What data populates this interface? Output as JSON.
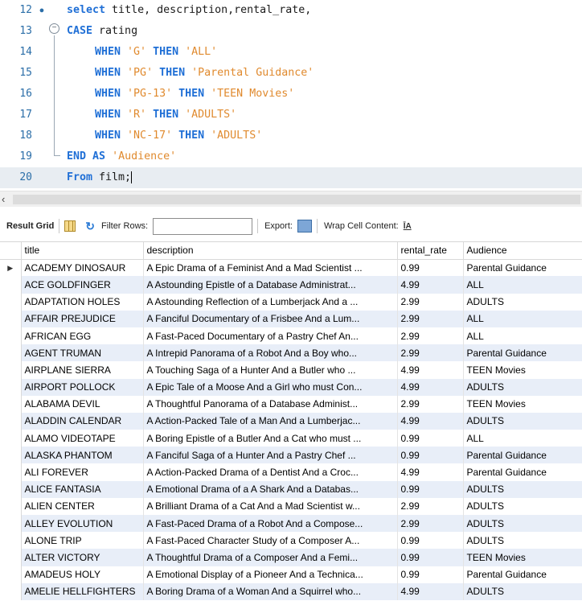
{
  "editor": {
    "lines": [
      {
        "num": "12",
        "parts": [
          {
            "t": "select",
            "k": "kw"
          },
          {
            "t": " title, description,rental_rate,",
            "k": ""
          }
        ]
      },
      {
        "num": "13",
        "parts": [
          {
            "t": "CASE",
            "k": "kw"
          },
          {
            "t": " rating",
            "k": ""
          }
        ]
      },
      {
        "num": "14",
        "parts": [
          {
            "t": "WHEN",
            "k": "kw"
          },
          {
            "t": " ",
            "k": ""
          },
          {
            "t": "'G'",
            "k": "str"
          },
          {
            "t": " ",
            "k": ""
          },
          {
            "t": "THEN",
            "k": "kw"
          },
          {
            "t": " ",
            "k": ""
          },
          {
            "t": "'ALL'",
            "k": "str"
          }
        ]
      },
      {
        "num": "15",
        "parts": [
          {
            "t": "WHEN",
            "k": "kw"
          },
          {
            "t": " ",
            "k": ""
          },
          {
            "t": "'PG'",
            "k": "str"
          },
          {
            "t": " ",
            "k": ""
          },
          {
            "t": "THEN",
            "k": "kw"
          },
          {
            "t": " ",
            "k": ""
          },
          {
            "t": "'Parental Guidance'",
            "k": "str"
          }
        ]
      },
      {
        "num": "16",
        "parts": [
          {
            "t": "WHEN",
            "k": "kw"
          },
          {
            "t": " ",
            "k": ""
          },
          {
            "t": "'PG-13'",
            "k": "str"
          },
          {
            "t": " ",
            "k": ""
          },
          {
            "t": "THEN",
            "k": "kw"
          },
          {
            "t": " ",
            "k": ""
          },
          {
            "t": "'TEEN Movies'",
            "k": "str"
          }
        ]
      },
      {
        "num": "17",
        "parts": [
          {
            "t": "WHEN",
            "k": "kw"
          },
          {
            "t": " ",
            "k": ""
          },
          {
            "t": "'R'",
            "k": "str"
          },
          {
            "t": " ",
            "k": ""
          },
          {
            "t": "THEN",
            "k": "kw"
          },
          {
            "t": " ",
            "k": ""
          },
          {
            "t": "'ADULTS'",
            "k": "str"
          }
        ]
      },
      {
        "num": "18",
        "parts": [
          {
            "t": "WHEN",
            "k": "kw"
          },
          {
            "t": " ",
            "k": ""
          },
          {
            "t": "'NC-17'",
            "k": "str"
          },
          {
            "t": " ",
            "k": ""
          },
          {
            "t": "THEN",
            "k": "kw"
          },
          {
            "t": " ",
            "k": ""
          },
          {
            "t": "'ADULTS'",
            "k": "str"
          }
        ]
      },
      {
        "num": "19",
        "parts": [
          {
            "t": "END",
            "k": "kw"
          },
          {
            "t": " ",
            "k": ""
          },
          {
            "t": "AS",
            "k": "kw"
          },
          {
            "t": " ",
            "k": ""
          },
          {
            "t": "'Audience'",
            "k": "str"
          }
        ]
      },
      {
        "num": "20",
        "parts": [
          {
            "t": "From",
            "k": "kw"
          },
          {
            "t": " film;",
            "k": ""
          }
        ]
      }
    ]
  },
  "toolbar": {
    "result_grid_label": "Result Grid",
    "filter_rows_label": "Filter Rows:",
    "filter_rows_value": "",
    "export_label": "Export:",
    "wrap_label": "Wrap Cell Content:",
    "wrap_icon": "ĪA"
  },
  "grid": {
    "columns": [
      "title",
      "description",
      "rental_rate",
      "Audience"
    ],
    "row_indicator": "▶",
    "rows": [
      [
        "ACADEMY DINOSAUR",
        "A Epic Drama of a Feminist And a Mad Scientist ...",
        "0.99",
        "Parental Guidance"
      ],
      [
        "ACE GOLDFINGER",
        "A Astounding Epistle of a Database Administrat...",
        "4.99",
        "ALL"
      ],
      [
        "ADAPTATION HOLES",
        "A Astounding Reflection of a Lumberjack And a ...",
        "2.99",
        "ADULTS"
      ],
      [
        "AFFAIR PREJUDICE",
        "A Fanciful Documentary of a Frisbee And a Lum...",
        "2.99",
        "ALL"
      ],
      [
        "AFRICAN EGG",
        "A Fast-Paced Documentary of a Pastry Chef An...",
        "2.99",
        "ALL"
      ],
      [
        "AGENT TRUMAN",
        "A Intrepid Panorama of a Robot And a Boy who...",
        "2.99",
        "Parental Guidance"
      ],
      [
        "AIRPLANE SIERRA",
        "A Touching Saga of a Hunter And a Butler who ...",
        "4.99",
        "TEEN Movies"
      ],
      [
        "AIRPORT POLLOCK",
        "A Epic Tale of a Moose And a Girl who must Con...",
        "4.99",
        "ADULTS"
      ],
      [
        "ALABAMA DEVIL",
        "A Thoughtful Panorama of a Database Administ...",
        "2.99",
        "TEEN Movies"
      ],
      [
        "ALADDIN CALENDAR",
        "A Action-Packed Tale of a Man And a Lumberjac...",
        "4.99",
        "ADULTS"
      ],
      [
        "ALAMO VIDEOTAPE",
        "A Boring Epistle of a Butler And a Cat who must ...",
        "0.99",
        "ALL"
      ],
      [
        "ALASKA PHANTOM",
        "A Fanciful Saga of a Hunter And a Pastry Chef ...",
        "0.99",
        "Parental Guidance"
      ],
      [
        "ALI FOREVER",
        "A Action-Packed Drama of a Dentist And a Croc...",
        "4.99",
        "Parental Guidance"
      ],
      [
        "ALICE FANTASIA",
        "A Emotional Drama of a A Shark And a Databas...",
        "0.99",
        "ADULTS"
      ],
      [
        "ALIEN CENTER",
        "A Brilliant Drama of a Cat And a Mad Scientist w...",
        "2.99",
        "ADULTS"
      ],
      [
        "ALLEY EVOLUTION",
        "A Fast-Paced Drama of a Robot And a Compose...",
        "2.99",
        "ADULTS"
      ],
      [
        "ALONE TRIP",
        "A Fast-Paced Character Study of a Composer A...",
        "0.99",
        "ADULTS"
      ],
      [
        "ALTER VICTORY",
        "A Thoughtful Drama of a Composer And a Femi...",
        "0.99",
        "TEEN Movies"
      ],
      [
        "AMADEUS HOLY",
        "A Emotional Display of a Pioneer And a Technica...",
        "0.99",
        "Parental Guidance"
      ],
      [
        "AMELIE HELLFIGHTERS",
        "A Boring Drama of a Woman And a Squirrel who...",
        "4.99",
        "ADULTS"
      ]
    ]
  }
}
